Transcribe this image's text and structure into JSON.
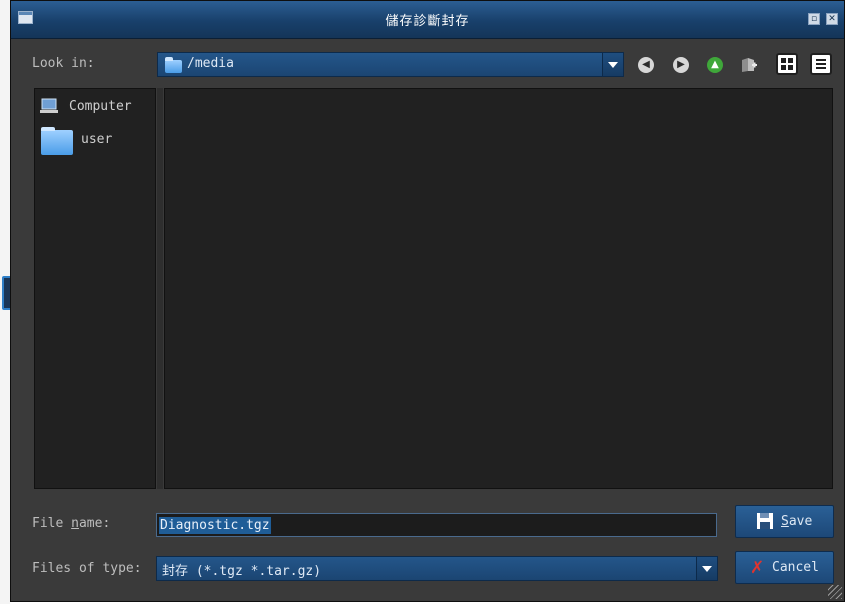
{
  "window": {
    "title": "儲存診斷封存"
  },
  "lookin": {
    "label": "Look in:",
    "path": "/media"
  },
  "sidebar": {
    "items": [
      {
        "label": "Computer",
        "icon": "computer-icon"
      },
      {
        "label": "user",
        "icon": "folder-icon"
      }
    ]
  },
  "toolbar": {
    "icons": [
      "back-arrow-icon",
      "forward-arrow-icon",
      "up-arrow-icon",
      "new-folder-icon",
      "icon-view-icon",
      "list-view-icon"
    ]
  },
  "filename": {
    "label_pre": "File ",
    "label_u": "n",
    "label_post": "ame:",
    "value": "Diagnostic.tgz"
  },
  "filetype": {
    "label": "Files of type:",
    "value": "封存 (*.tgz *.tar.gz)"
  },
  "buttons": {
    "save_u": "S",
    "save_rest": "ave",
    "cancel": "Cancel"
  },
  "colors": {
    "accent": "#1b4572",
    "selection": "#1f5d97",
    "background": "#3a3a3a",
    "pane": "#212121"
  }
}
